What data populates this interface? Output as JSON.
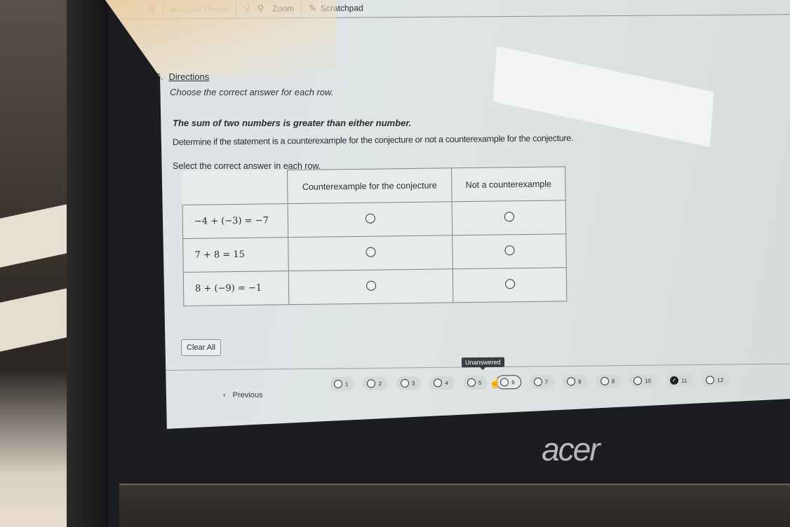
{
  "toolbar": {
    "items": [
      {
        "icon": "calculator-icon",
        "label": ""
      },
      {
        "icon": "palette-icon",
        "label": "Color Theme"
      },
      {
        "icon": "zoom-out-icon",
        "label": ""
      },
      {
        "icon": "zoom-in-icon",
        "label": "Zoom"
      },
      {
        "icon": "scratchpad-icon",
        "label": "Scratchpad"
      }
    ]
  },
  "question": {
    "number": "6.",
    "directions_label": "Directions",
    "instruction": "Choose the correct answer for each row.",
    "conjecture": "The sum of two numbers is greater than either number.",
    "determine": "Determine if the statement is a counterexample for the conjecture or not a counterexample for the conjecture.",
    "select": "Select the correct answer in each row."
  },
  "table": {
    "headers": [
      "Counterexample for the conjecture",
      "Not a counterexample"
    ],
    "rows": [
      {
        "statement": "−4 + (−3) = −7",
        "selected": null
      },
      {
        "statement": "7 + 8 = 15",
        "selected": null
      },
      {
        "statement": "8 + (−9) = −1",
        "selected": null
      }
    ]
  },
  "clear_all_label": "Clear All",
  "navigation": {
    "previous_label": "Previous",
    "previous_icon": "chevron-left-icon",
    "tooltip": "Unanswered",
    "current_question": 6,
    "questions": [
      {
        "num": "1",
        "status": "unanswered"
      },
      {
        "num": "2",
        "status": "unanswered"
      },
      {
        "num": "3",
        "status": "unanswered"
      },
      {
        "num": "4",
        "status": "unanswered"
      },
      {
        "num": "5",
        "status": "unanswered"
      },
      {
        "num": "6",
        "status": "current"
      },
      {
        "num": "7",
        "status": "unanswered"
      },
      {
        "num": "8",
        "status": "unanswered"
      },
      {
        "num": "9",
        "status": "unanswered"
      },
      {
        "num": "10",
        "status": "unanswered"
      },
      {
        "num": "11",
        "status": "answered"
      },
      {
        "num": "12",
        "status": "unanswered"
      }
    ]
  },
  "device": {
    "brand": "acer"
  }
}
